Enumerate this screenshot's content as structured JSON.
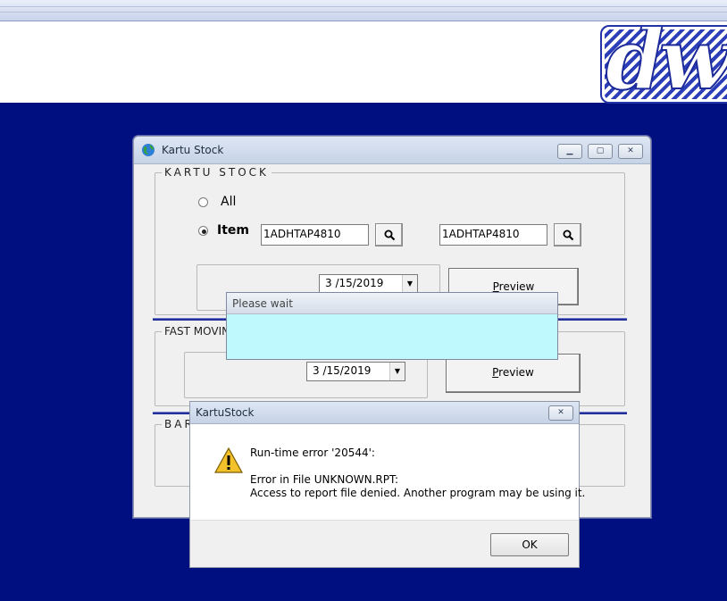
{
  "background_app": {
    "logo_text": "dw"
  },
  "main_window": {
    "title": "Kartu Stock",
    "groups": {
      "kartu_stock": {
        "label": "KARTU STOCK",
        "radio_all_label": "All",
        "radio_item_label": "Item",
        "item_from": "1ADHTAP4810",
        "item_to": "1ADHTAP4810",
        "date": "3 /15/2019",
        "preview_label": "Preview",
        "preview_mnemonic": "P",
        "preview_rest": "review"
      },
      "fast_moving": {
        "label": "FAST MOVING",
        "date": "3 /15/2019",
        "preview_label": "Preview",
        "preview_mnemonic": "P",
        "preview_rest": "review"
      },
      "barcode": {
        "label": "BAR"
      }
    }
  },
  "wait_dialog": {
    "title": "Please wait"
  },
  "error_dialog": {
    "title": "KartuStock",
    "line1": "Run-time error '20544':",
    "line2": "Error in File UNKNOWN.RPT:",
    "line3": "Access to report file denied. Another program may be using it.",
    "ok_label": "OK"
  },
  "colors": {
    "desktop": "#000f80",
    "wait_body": "#bff9fd",
    "separator": "#23309a"
  }
}
